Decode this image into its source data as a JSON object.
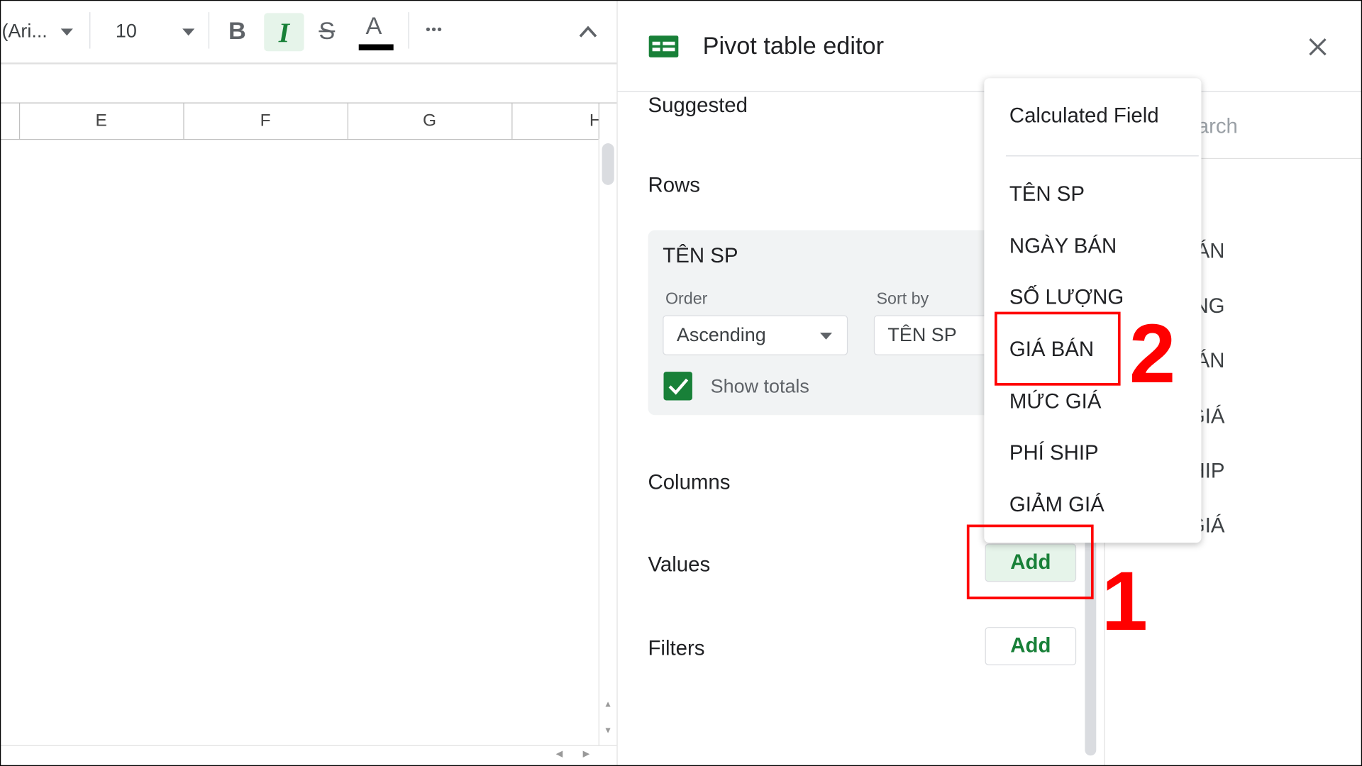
{
  "toolbar": {
    "font_name": "(Ari...",
    "font_size": "10",
    "bold_icon": "B",
    "italic_icon": "I",
    "strikethrough_icon": "S",
    "text_color_icon": "A",
    "more_icon": "•••",
    "italic_active": true,
    "text_color": "#000000"
  },
  "sheet": {
    "columns": [
      "E",
      "F",
      "G",
      "H"
    ]
  },
  "panel": {
    "title": "Pivot table editor",
    "suggested_label": "Suggested",
    "rows_label": "Rows",
    "row_card": {
      "field": "TÊN SP",
      "order_label": "Order",
      "order_value": "Ascending",
      "sort_by_label": "Sort by",
      "sort_by_value": "TÊN SP",
      "show_totals_label": "Show totals",
      "show_totals_checked": true
    },
    "columns_label": "Columns",
    "values_label": "Values",
    "filters_label": "Filters",
    "add_label": "Add",
    "search_placeholder": "Search",
    "fields": [
      "NGÀY BÁN",
      "SỐ LƯỢNG",
      "GIÁ BÁN",
      "MỨC GIÁ",
      "PHÍ SHIP",
      "GIẢM GIÁ"
    ]
  },
  "menu": {
    "calculated_field": "Calculated Field",
    "items": [
      "TÊN SP",
      "NGÀY BÁN",
      "SỐ LƯỢNG",
      "GIÁ BÁN",
      "MỨC GIÁ",
      "PHÍ SHIP",
      "GIẢM GIÁ"
    ]
  },
  "annotations": {
    "step1": "1",
    "step2": "2",
    "color": "#ff0000"
  },
  "colors": {
    "accent_green": "#188038",
    "active_bg": "#e6f4ea"
  }
}
